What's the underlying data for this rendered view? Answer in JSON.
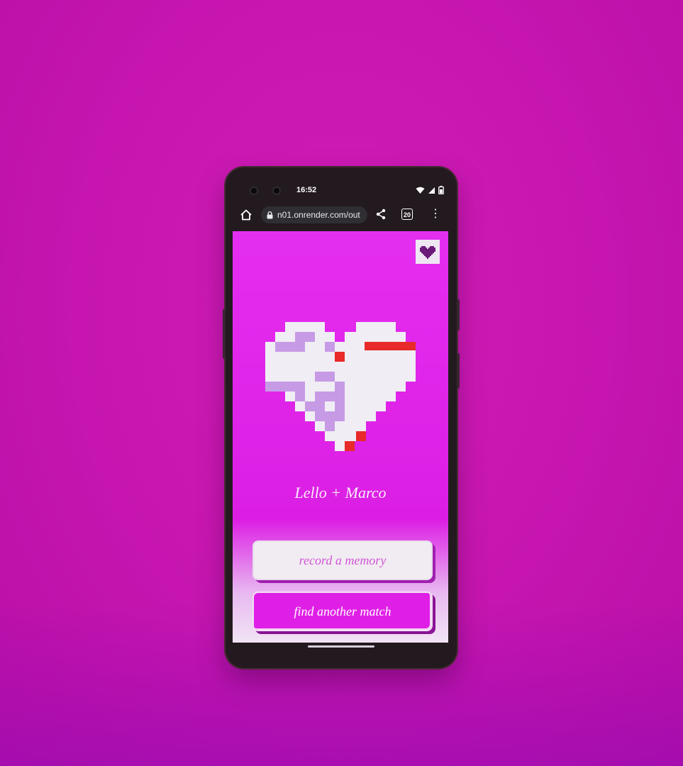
{
  "status_bar": {
    "time": "16:52",
    "icons": [
      "wifi-icon",
      "signal-icon",
      "battery-icon"
    ]
  },
  "browser": {
    "url": "n01.onrender.com/out",
    "tab_count": "20",
    "icons": [
      "home-icon",
      "lock-icon",
      "share-icon",
      "tabs-icon",
      "more-icon"
    ]
  },
  "app": {
    "corner_icon": "pixel-heart-icon",
    "couple_names": "Lello + Marco",
    "record_button_label": "record a memory",
    "match_button_label": "find another match"
  },
  "colors": {
    "background": "#c615b0",
    "screen_top": "#e42ef0",
    "heart_light": "#f0eef4",
    "heart_lavender": "#c79ae6",
    "heart_red": "#e82a2a",
    "accent": "#e01fe6"
  }
}
